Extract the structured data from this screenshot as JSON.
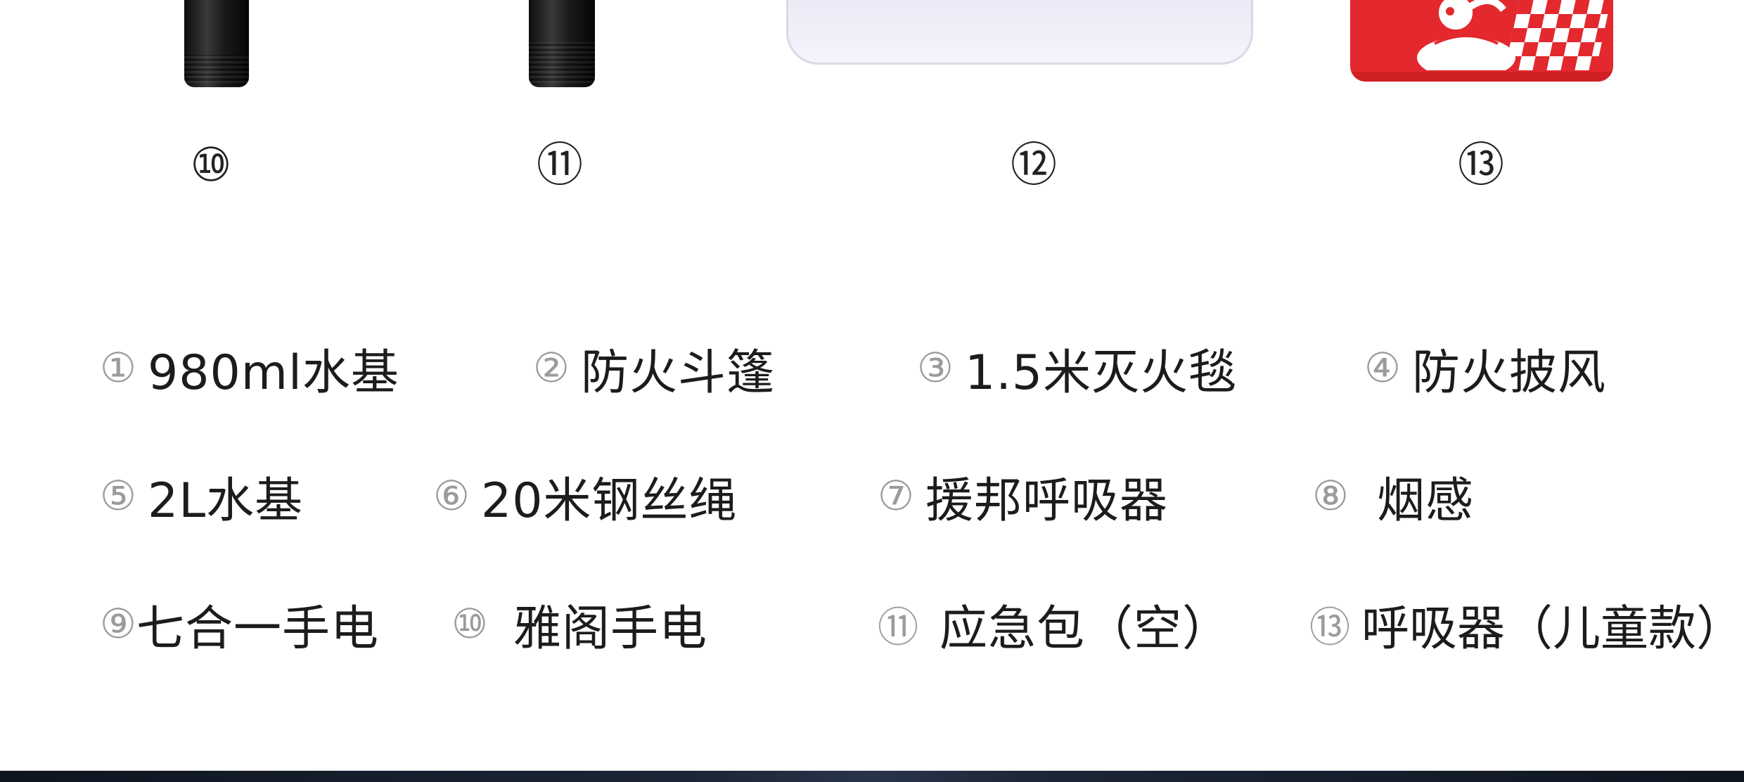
{
  "products": [
    {
      "num": "⑩",
      "icon": "flashlight-icon"
    },
    {
      "num": "⑪",
      "icon": "flashlight-icon"
    },
    {
      "num": "⑫",
      "icon": "emergency-bag-icon"
    },
    {
      "num": "⑬",
      "icon": "child-respirator-box-icon"
    }
  ],
  "items": [
    {
      "num": "①",
      "label": "980ml水基"
    },
    {
      "num": "②",
      "label": "防火斗篷"
    },
    {
      "num": "③",
      "label": "1.5米灭火毯"
    },
    {
      "num": "④",
      "label": "防火披风"
    },
    {
      "num": "⑤",
      "label": "2L水基"
    },
    {
      "num": "⑥",
      "label": "20米钢丝绳"
    },
    {
      "num": "⑦",
      "label": "援邦呼吸器"
    },
    {
      "num": "⑧",
      "label": "烟感"
    },
    {
      "num": "⑨",
      "label": "七合一手电"
    },
    {
      "num": "⑩",
      "label": "雅阁手电"
    },
    {
      "num": "⑪",
      "label": "应急包（空）"
    },
    {
      "num": "⑬",
      "label": "呼吸器（儿童款）"
    }
  ],
  "colors": {
    "accent_red": "#e3282e",
    "bag_lavender": "#ebeaf7",
    "bottom_bar": "#1d2636"
  }
}
